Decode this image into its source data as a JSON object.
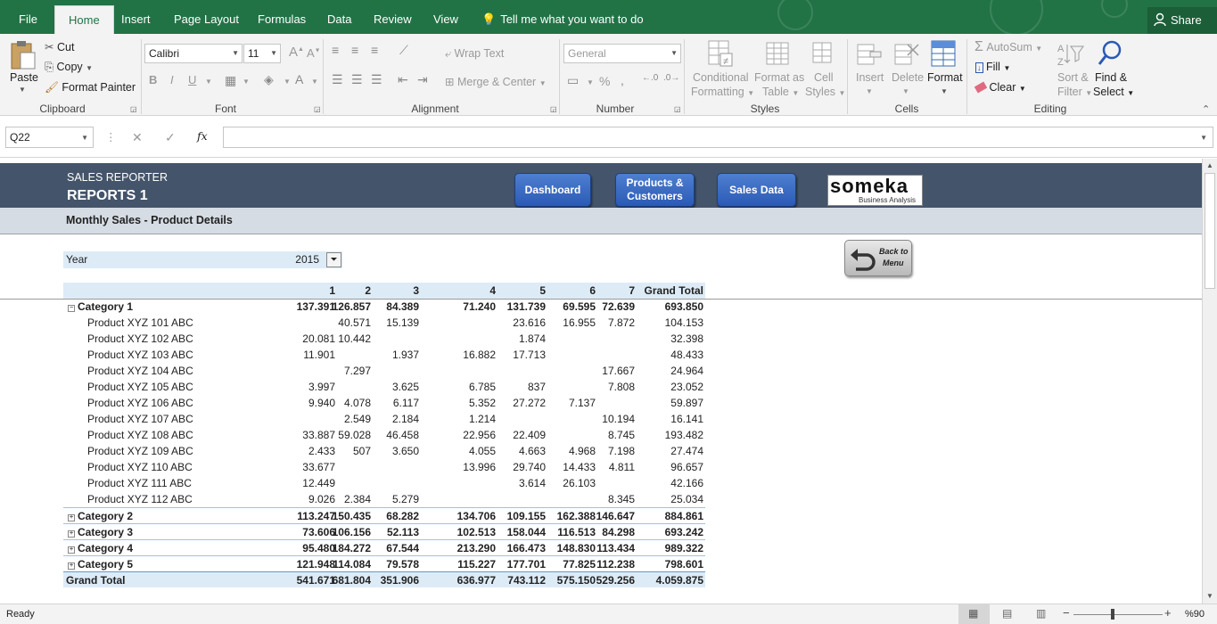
{
  "tabs": [
    {
      "label": "File"
    },
    {
      "label": "Home"
    },
    {
      "label": "Insert"
    },
    {
      "label": "Page Layout"
    },
    {
      "label": "Formulas"
    },
    {
      "label": "Data"
    },
    {
      "label": "Review"
    },
    {
      "label": "View"
    }
  ],
  "tell_me": "Tell me what you want to do",
  "share": "Share",
  "ribbon": {
    "clipboard": {
      "paste": "Paste",
      "cut": "Cut",
      "copy": "Copy",
      "format_painter": "Format Painter",
      "label": "Clipboard"
    },
    "font": {
      "name": "Calibri",
      "size": "11",
      "label": "Font",
      "bold": "B",
      "italic": "I",
      "underline": "U"
    },
    "alignment": {
      "wrap_text": "Wrap Text",
      "merge_center": "Merge & Center",
      "label": "Alignment"
    },
    "number": {
      "format": "General",
      "percent": "%",
      "label": "Number"
    },
    "styles": {
      "conditional_1": "Conditional",
      "conditional_2": "Formatting",
      "format_as_1": "Format as",
      "format_as_2": "Table",
      "cell_1": "Cell",
      "cell_2": "Styles",
      "label": "Styles"
    },
    "cells": {
      "insert": "Insert",
      "delete": "Delete",
      "format": "Format",
      "label": "Cells"
    },
    "editing": {
      "autosum": "AutoSum",
      "fill": "Fill",
      "clear": "Clear",
      "sort_1": "Sort &",
      "sort_2": "Filter",
      "find_1": "Find &",
      "find_2": "Select",
      "label": "Editing"
    }
  },
  "formula_bar": {
    "name_box": "Q22",
    "fx": "fx",
    "cancel": "✕",
    "enter": "✓"
  },
  "report": {
    "app_title": "SALES REPORTER",
    "report_title": "REPORTS 1",
    "subtitle": "Monthly Sales - Product Details",
    "nav": {
      "dashboard": "Dashboard",
      "products_customers_1": "Products &",
      "products_customers_2": "Customers",
      "sales_data": "Sales Data"
    },
    "logo_text": "someka",
    "logo_sub": "Business Analysis",
    "back_1": "Back to",
    "back_2": "Menu",
    "filter": {
      "label": "Year",
      "value": "2015"
    }
  },
  "pivot": {
    "columns": [
      "1",
      "2",
      "3",
      "4",
      "5",
      "6",
      "7",
      "Grand Total"
    ],
    "rows": [
      {
        "label": "Category 1",
        "type": "cat",
        "exp": "⊖",
        "v": [
          "137.391",
          "126.857",
          "84.389",
          "71.240",
          "131.739",
          "69.595",
          "72.639",
          "693.850"
        ]
      },
      {
        "label": "Product XYZ 101 ABC",
        "type": "item",
        "v": [
          "",
          "40.571",
          "15.139",
          "",
          "23.616",
          "16.955",
          "7.872",
          "104.153"
        ]
      },
      {
        "label": "Product XYZ 102 ABC",
        "type": "item",
        "v": [
          "20.081",
          "10.442",
          "",
          "",
          "1.874",
          "",
          "",
          "32.398"
        ]
      },
      {
        "label": "Product XYZ 103 ABC",
        "type": "item",
        "v": [
          "11.901",
          "",
          "1.937",
          "16.882",
          "17.713",
          "",
          "",
          "48.433"
        ]
      },
      {
        "label": "Product XYZ 104 ABC",
        "type": "item",
        "v": [
          "",
          "7.297",
          "",
          "",
          "",
          "",
          "17.667",
          "24.964"
        ]
      },
      {
        "label": "Product XYZ 105 ABC",
        "type": "item",
        "v": [
          "3.997",
          "",
          "3.625",
          "6.785",
          "837",
          "",
          "7.808",
          "23.052"
        ]
      },
      {
        "label": "Product XYZ 106 ABC",
        "type": "item",
        "v": [
          "9.940",
          "4.078",
          "6.117",
          "5.352",
          "27.272",
          "7.137",
          "",
          "59.897"
        ]
      },
      {
        "label": "Product XYZ 107 ABC",
        "type": "item",
        "v": [
          "",
          "2.549",
          "2.184",
          "1.214",
          "",
          "",
          "10.194",
          "16.141"
        ]
      },
      {
        "label": "Product XYZ 108 ABC",
        "type": "item",
        "v": [
          "33.887",
          "59.028",
          "46.458",
          "22.956",
          "22.409",
          "",
          "8.745",
          "193.482"
        ]
      },
      {
        "label": "Product XYZ 109 ABC",
        "type": "item",
        "v": [
          "2.433",
          "507",
          "3.650",
          "4.055",
          "4.663",
          "4.968",
          "7.198",
          "27.474"
        ]
      },
      {
        "label": "Product XYZ 110 ABC",
        "type": "item",
        "v": [
          "33.677",
          "",
          "",
          "13.996",
          "29.740",
          "14.433",
          "4.811",
          "96.657"
        ]
      },
      {
        "label": "Product XYZ 111 ABC",
        "type": "item",
        "v": [
          "12.449",
          "",
          "",
          "",
          "3.614",
          "26.103",
          "",
          "42.166"
        ]
      },
      {
        "label": "Product XYZ 112 ABC",
        "type": "item",
        "v": [
          "9.026",
          "2.384",
          "5.279",
          "",
          "",
          "",
          "8.345",
          "25.034"
        ]
      },
      {
        "label": "Category 2",
        "type": "cat",
        "exp": "⊕",
        "v": [
          "113.247",
          "150.435",
          "68.282",
          "134.706",
          "109.155",
          "162.388",
          "146.647",
          "884.861"
        ]
      },
      {
        "label": "Category 3",
        "type": "cat",
        "exp": "⊕",
        "v": [
          "73.606",
          "106.156",
          "52.113",
          "102.513",
          "158.044",
          "116.513",
          "84.298",
          "693.242"
        ]
      },
      {
        "label": "Category 4",
        "type": "cat",
        "exp": "⊕",
        "v": [
          "95.480",
          "184.272",
          "67.544",
          "213.290",
          "166.473",
          "148.830",
          "113.434",
          "989.322"
        ]
      },
      {
        "label": "Category 5",
        "type": "cat",
        "exp": "⊕",
        "v": [
          "121.948",
          "114.084",
          "79.578",
          "115.227",
          "177.701",
          "77.825",
          "112.238",
          "798.601"
        ]
      },
      {
        "label": "Grand Total",
        "type": "total",
        "v": [
          "541.671",
          "681.804",
          "351.906",
          "636.977",
          "743.112",
          "575.150",
          "529.256",
          "4.059.875"
        ]
      }
    ]
  },
  "status": {
    "ready": "Ready",
    "zoom": "%90",
    "minus": "−",
    "plus": "+"
  },
  "colors": {
    "excel_green": "#217346",
    "band": "#44546a",
    "subband": "#d6dce4",
    "header_blue": "#ddebf7",
    "nav_blue": "#2a5ab5"
  }
}
